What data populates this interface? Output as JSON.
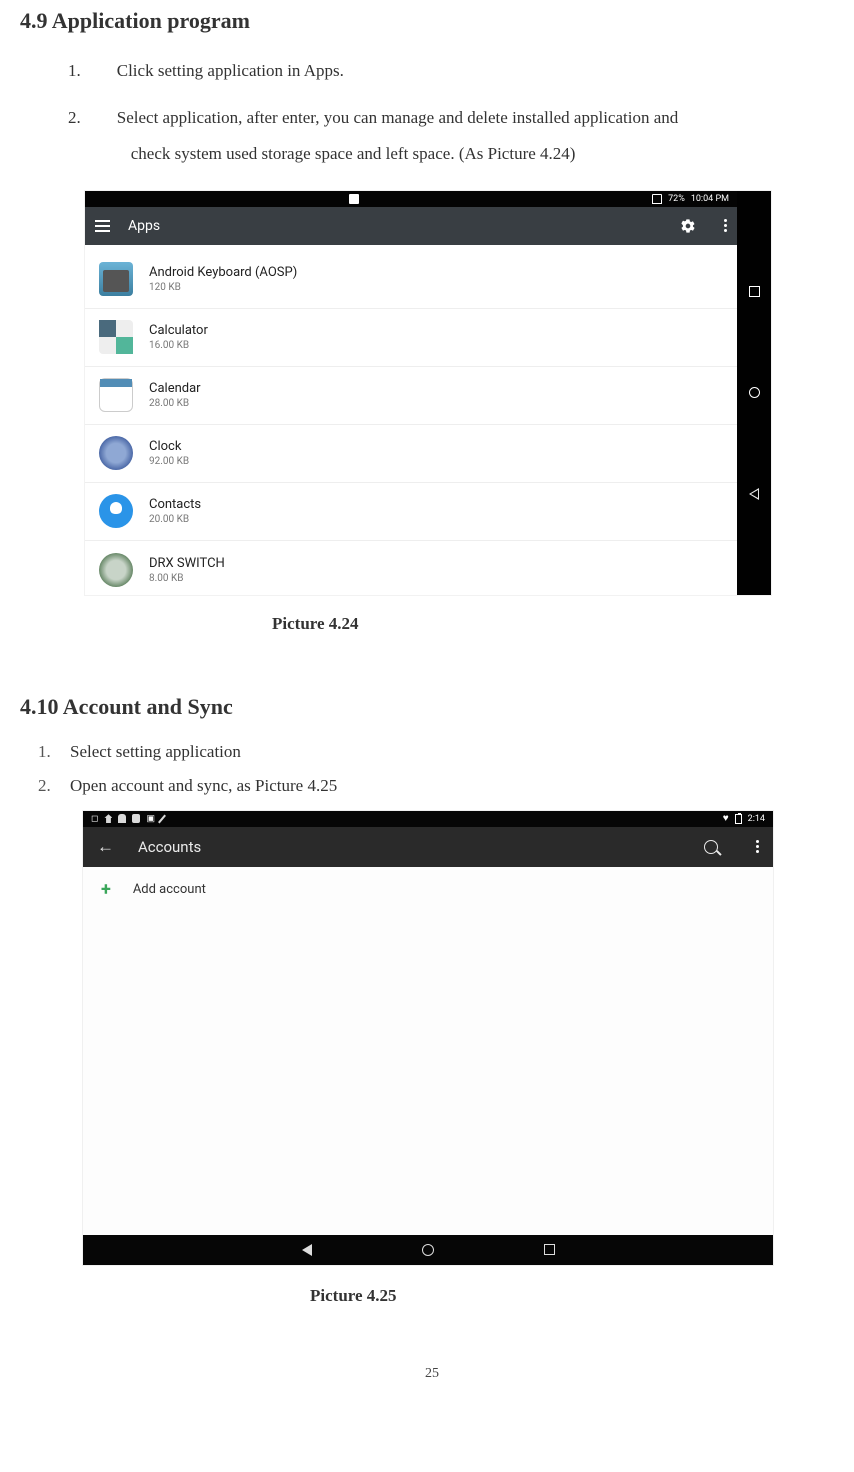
{
  "section49": {
    "heading": "4.9  Application program",
    "items": [
      {
        "num": "1.",
        "text": "Click setting application in Apps."
      },
      {
        "num": "2.",
        "text": "Select application, after enter, you can manage and delete installed application and",
        "text2": "check system used storage space and left space. (As Picture 4.24)"
      }
    ],
    "caption": "Picture 4.24"
  },
  "shot1": {
    "status": {
      "battery": "72%",
      "time": "10:04 PM"
    },
    "title": "Apps",
    "apps": [
      {
        "name": "Android Keyboard (AOSP)",
        "size": "120 KB"
      },
      {
        "name": "Calculator",
        "size": "16.00 KB"
      },
      {
        "name": "Calendar",
        "size": "28.00 KB"
      },
      {
        "name": "Clock",
        "size": "92.00 KB"
      },
      {
        "name": "Contacts",
        "size": "20.00 KB"
      },
      {
        "name": "DRX SWITCH",
        "size": "8.00 KB"
      }
    ]
  },
  "section410": {
    "heading": "4.10 Account and Sync",
    "items": [
      {
        "num": "1.",
        "text": "Select setting application"
      },
      {
        "num": "2.",
        "text": "Open account and sync, as Picture 4.25"
      }
    ],
    "caption": "Picture 4.25"
  },
  "shot2": {
    "status": {
      "time": "2:14"
    },
    "title": "Accounts",
    "add": "Add account"
  },
  "pageNumber": "25"
}
